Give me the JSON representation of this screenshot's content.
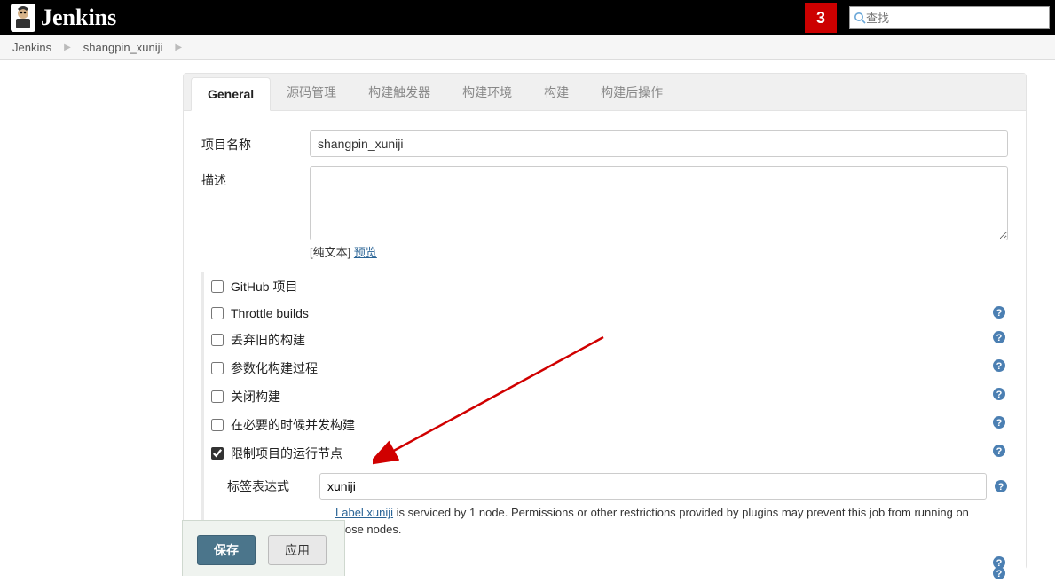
{
  "header": {
    "brand": "Jenkins",
    "notif_count": "3",
    "search_placeholder": "查找"
  },
  "breadcrumbs": {
    "root": "Jenkins",
    "item": "shangpin_xuniji"
  },
  "tabs": [
    {
      "label": "General",
      "active": true
    },
    {
      "label": "源码管理",
      "active": false
    },
    {
      "label": "构建触发器",
      "active": false
    },
    {
      "label": "构建环境",
      "active": false
    },
    {
      "label": "构建",
      "active": false
    },
    {
      "label": "构建后操作",
      "active": false
    }
  ],
  "form": {
    "project_name_label": "项目名称",
    "project_name_value": "shangpin_xuniji",
    "description_label": "描述",
    "description_value": "",
    "plain_text_label": "[纯文本] ",
    "preview_link": "预览"
  },
  "options": [
    {
      "label": "GitHub 项目",
      "checked": false,
      "help": false
    },
    {
      "label": "Throttle builds",
      "checked": false,
      "help": true
    },
    {
      "label": "丢弃旧的构建",
      "checked": false,
      "help": true
    },
    {
      "label": "参数化构建过程",
      "checked": false,
      "help": true
    },
    {
      "label": "关闭构建",
      "checked": false,
      "help": true
    },
    {
      "label": "在必要的时候并发构建",
      "checked": false,
      "help": true
    },
    {
      "label": "限制项目的运行节点",
      "checked": true,
      "help": true
    }
  ],
  "label_expr": {
    "label": "标签表达式",
    "value": "xuniji",
    "note_link": "Label xuniji",
    "note_rest": " is serviced by 1 node. Permissions or other restrictions provided by plugins may prevent this job from running on those nodes."
  },
  "footer": {
    "save": "保存",
    "apply": "应用"
  }
}
